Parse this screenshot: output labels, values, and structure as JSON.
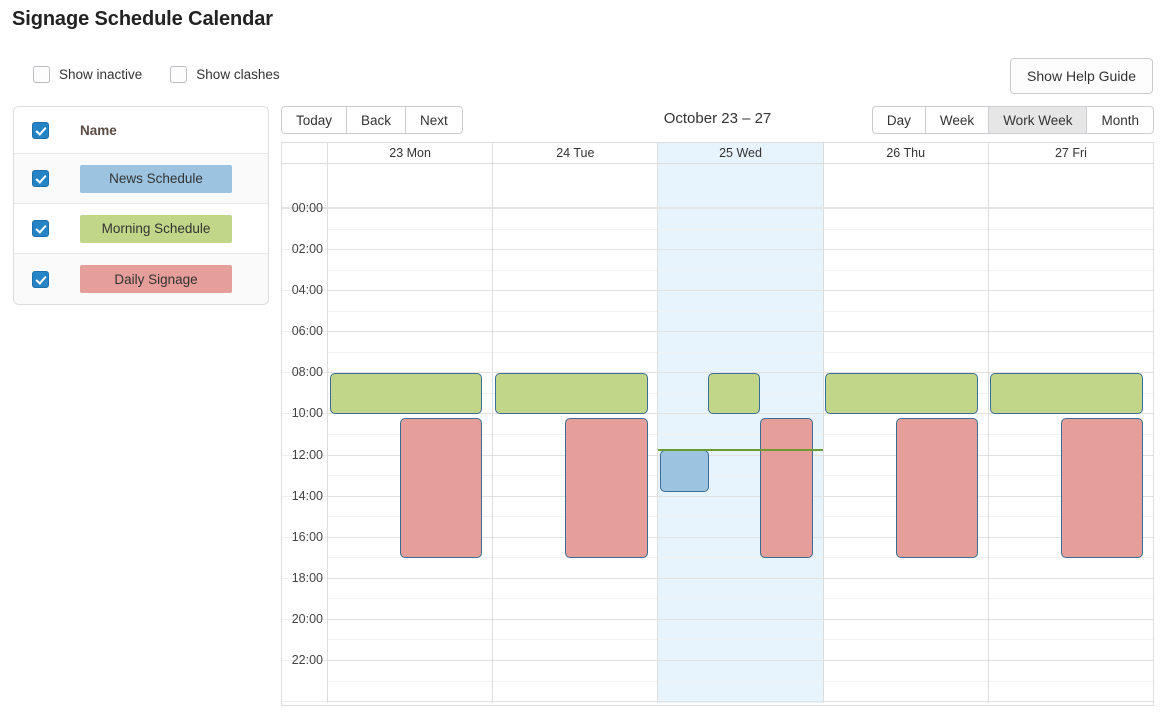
{
  "header": {
    "title": "Signage Schedule Calendar",
    "help_button": "Show Help Guide"
  },
  "filters": [
    {
      "label": "Show inactive",
      "checked": false
    },
    {
      "label": "Show clashes",
      "checked": false
    }
  ],
  "sidebar": {
    "header": {
      "label": "Name",
      "checked": true
    },
    "items": [
      {
        "label": "News Schedule",
        "checked": true,
        "color": "#9cc3e0"
      },
      {
        "label": "Morning Schedule",
        "checked": true,
        "color": "#c2d68a"
      },
      {
        "label": "Daily Signage",
        "checked": true,
        "color": "#e59e99"
      }
    ]
  },
  "toolbar": {
    "nav": [
      "Today",
      "Back",
      "Next"
    ],
    "range_label": "October 23 – 27",
    "views": [
      "Day",
      "Week",
      "Work Week",
      "Month"
    ],
    "active_view": "Work Week"
  },
  "calendar": {
    "days": [
      {
        "label": "23 Mon",
        "today": false
      },
      {
        "label": "24 Tue",
        "today": false
      },
      {
        "label": "25 Wed",
        "today": true
      },
      {
        "label": "26 Thu",
        "today": false
      },
      {
        "label": "27 Fri",
        "today": false
      }
    ],
    "time_labels": [
      "00:00",
      "02:00",
      "04:00",
      "06:00",
      "08:00",
      "10:00",
      "12:00",
      "14:00",
      "16:00",
      "18:00",
      "20:00",
      "22:00"
    ],
    "slot_hours": 2,
    "day_start": "00:00",
    "day_end": "24:00",
    "now_indicator": {
      "day_index": 2,
      "time": "11:40",
      "color": "#6a9c2f"
    },
    "events": [
      {
        "schedule": "Morning Schedule",
        "day_index": 0,
        "start": "08:00",
        "end": "10:00",
        "color": "#c2d68a",
        "left_pct": 1,
        "width_pct": 93
      },
      {
        "schedule": "Daily Signage",
        "day_index": 0,
        "start": "10:10",
        "end": "17:00",
        "color": "#e59e99",
        "left_pct": 44,
        "width_pct": 50
      },
      {
        "schedule": "Morning Schedule",
        "day_index": 1,
        "start": "08:00",
        "end": "10:00",
        "color": "#c2d68a",
        "left_pct": 1,
        "width_pct": 93
      },
      {
        "schedule": "Daily Signage",
        "day_index": 1,
        "start": "10:10",
        "end": "17:00",
        "color": "#e59e99",
        "left_pct": 44,
        "width_pct": 50
      },
      {
        "schedule": "Morning Schedule",
        "day_index": 2,
        "start": "08:00",
        "end": "10:00",
        "color": "#c2d68a",
        "left_pct": 30,
        "width_pct": 32
      },
      {
        "schedule": "Daily Signage",
        "day_index": 2,
        "start": "10:10",
        "end": "17:00",
        "color": "#e59e99",
        "left_pct": 62,
        "width_pct": 32
      },
      {
        "schedule": "News Schedule",
        "day_index": 2,
        "start": "11:45",
        "end": "13:45",
        "color": "#9cc3e0",
        "left_pct": 1,
        "width_pct": 30
      },
      {
        "schedule": "Morning Schedule",
        "day_index": 3,
        "start": "08:00",
        "end": "10:00",
        "color": "#c2d68a",
        "left_pct": 1,
        "width_pct": 93
      },
      {
        "schedule": "Daily Signage",
        "day_index": 3,
        "start": "10:10",
        "end": "17:00",
        "color": "#e59e99",
        "left_pct": 44,
        "width_pct": 50
      },
      {
        "schedule": "Morning Schedule",
        "day_index": 4,
        "start": "08:00",
        "end": "10:00",
        "color": "#c2d68a",
        "left_pct": 1,
        "width_pct": 93
      },
      {
        "schedule": "Daily Signage",
        "day_index": 4,
        "start": "10:10",
        "end": "17:00",
        "color": "#e59e99",
        "left_pct": 44,
        "width_pct": 50
      }
    ]
  }
}
